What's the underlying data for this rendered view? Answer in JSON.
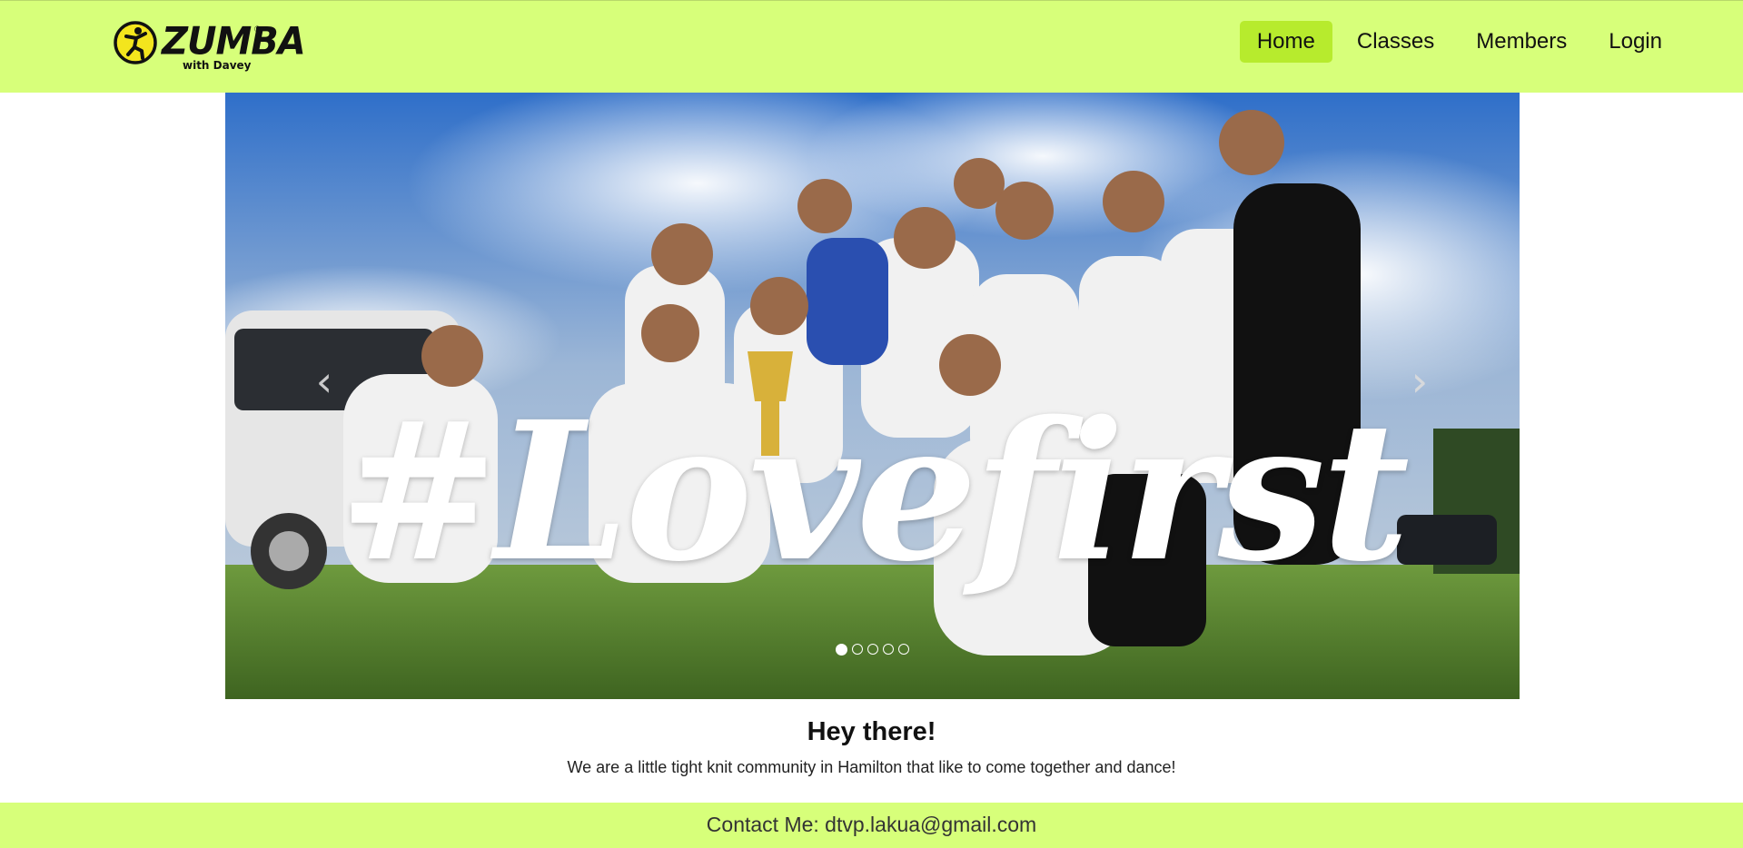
{
  "brand": {
    "name": "ZUMBA",
    "tm": "®",
    "subtitle": "with Davey",
    "colors": {
      "accent": "#d7ff7a",
      "active_nav": "#b7eb2d",
      "logo_mark": "#f3e51d"
    }
  },
  "nav": {
    "items": [
      {
        "label": "Home",
        "active": true
      },
      {
        "label": "Classes",
        "active": false
      },
      {
        "label": "Members",
        "active": false
      },
      {
        "label": "Login",
        "active": false
      }
    ]
  },
  "carousel": {
    "caption": "#Lovefirst",
    "prev_icon": "chevron-left-icon",
    "next_icon": "chevron-right-icon",
    "prev_glyph": "‹",
    "next_glyph": "›",
    "slide_count": 5,
    "active_slide": 1
  },
  "intro": {
    "heading": "Hey there!",
    "text": "We are a little tight knit community in Hamilton that like to come together and dance!"
  },
  "footer": {
    "contact": "Contact Me: dtvp.lakua@gmail.com"
  }
}
